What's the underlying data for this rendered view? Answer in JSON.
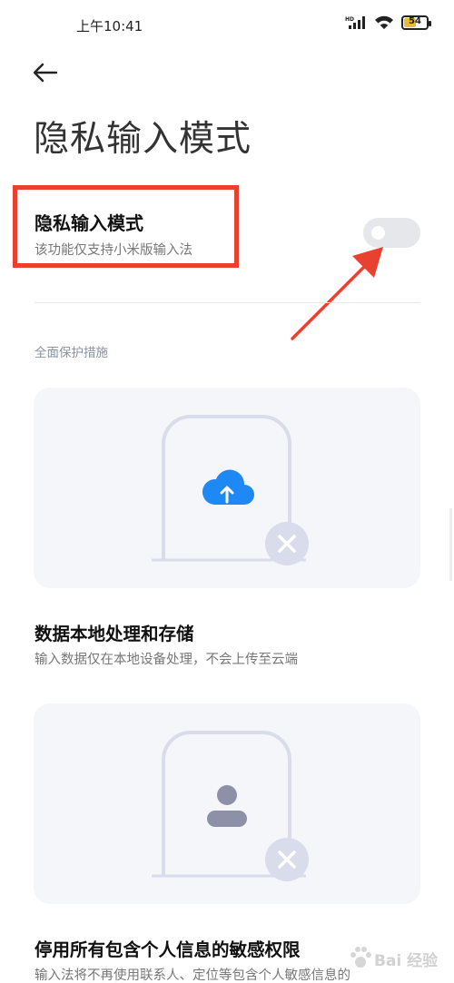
{
  "status_bar": {
    "time": "上午10:41",
    "battery_level": "54",
    "battery_fraction": 0.54,
    "icons": [
      "hd-signal-icon",
      "wifi-icon",
      "battery-icon"
    ],
    "battery_color": "#e8b93c"
  },
  "header": {
    "back_icon": "arrow-left-icon",
    "title": "隐私输入模式"
  },
  "setting": {
    "title": "隐私输入模式",
    "subtitle": "该功能仅支持小米版输入法",
    "toggle_on": false,
    "highlight_color": "#e8412f"
  },
  "section": {
    "header": "全面保护措施"
  },
  "features": [
    {
      "title": "数据本地处理和存储",
      "description": "输入数据仅在本地设备处理，不会上传至云端",
      "icon": "cloud-upload-icon",
      "icon_color": "#1e88f5"
    },
    {
      "title": "停用所有包含个人信息的敏感权限",
      "description": "输入法将不再使用联系人、定位等包含个人敏感信息的",
      "icon": "person-icon",
      "icon_color": "#8c91a7"
    }
  ],
  "watermark": {
    "text": "Bai 经验"
  }
}
